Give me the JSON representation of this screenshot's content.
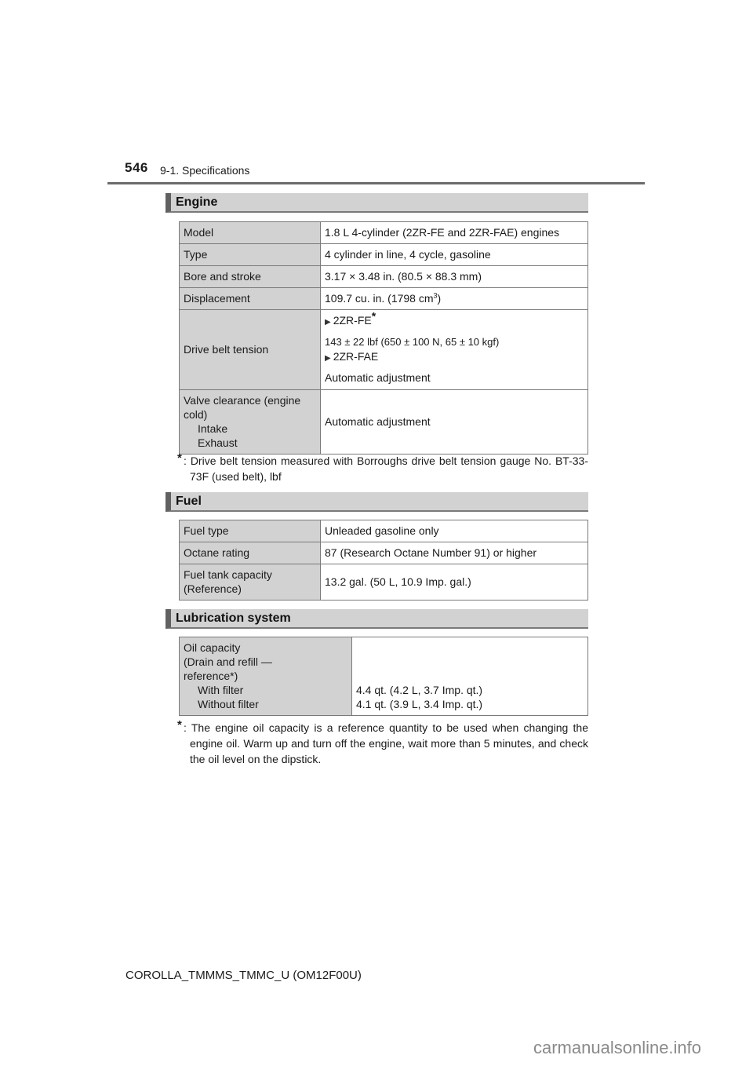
{
  "header": {
    "page_number": "546",
    "section": "9-1. Specifications"
  },
  "engine": {
    "title": "Engine",
    "rows": [
      {
        "label": "Model",
        "value": "1.8 L 4-cylinder (2ZR-FE and 2ZR-FAE) engines"
      },
      {
        "label": "Type",
        "value": "4 cylinder in line, 4 cycle, gasoline"
      },
      {
        "label": "Bore and stroke",
        "value": "3.17 × 3.48 in. (80.5 × 88.3 mm)"
      },
      {
        "label": "Displacement",
        "value": "109.7 cu. in. (1798 cm",
        "value_sup": "3",
        "value_suffix": ")"
      }
    ],
    "drive_belt": {
      "label": "Drive belt tension",
      "variant1": "2ZR-FE",
      "variant1_mark": "*",
      "variant1_value": "143 ± 22 lbf (650 ± 100 N, 65 ± 10 kgf)",
      "variant2": "2ZR-FAE",
      "variant2_value": "Automatic adjustment"
    },
    "valve": {
      "label_line1": "Valve clearance (engine",
      "label_line2": "cold)",
      "label_intake": "Intake",
      "label_exhaust": "Exhaust",
      "value": "Automatic adjustment"
    },
    "note_mark": "*",
    "note": ": Drive belt tension measured with Borroughs drive belt tension gauge No. BT-33-73F (used belt), lbf"
  },
  "fuel": {
    "title": "Fuel",
    "rows": [
      {
        "label": "Fuel type",
        "value": "Unleaded gasoline only"
      },
      {
        "label": "Octane rating",
        "value": "87 (Research Octane Number 91) or higher"
      },
      {
        "label_line1": "Fuel tank capacity",
        "label_line2": "(Reference)",
        "value": "13.2 gal. (50 L, 10.9 Imp. gal.)"
      }
    ]
  },
  "lubrication": {
    "title": "Lubrication system",
    "label_line1": "Oil capacity",
    "label_line2": "(Drain and refill —",
    "label_line3": "reference*)",
    "label_with": "With filter",
    "label_without": "Without filter",
    "value_with": "4.4 qt. (4.2 L, 3.7 Imp. qt.)",
    "value_without": "4.1 qt. (3.9 L, 3.4 Imp. qt.)",
    "note_mark": "*",
    "note": ": The engine oil capacity is a reference quantity to be used when changing the engine oil. Warm up and turn off the engine, wait more than 5 minutes, and check the oil level on the dipstick."
  },
  "footer": {
    "code": "COROLLA_TMMMS_TMMC_U (OM12F00U)",
    "watermark": "carmanualsonline.info"
  },
  "icons": {
    "bullet": "▶"
  }
}
